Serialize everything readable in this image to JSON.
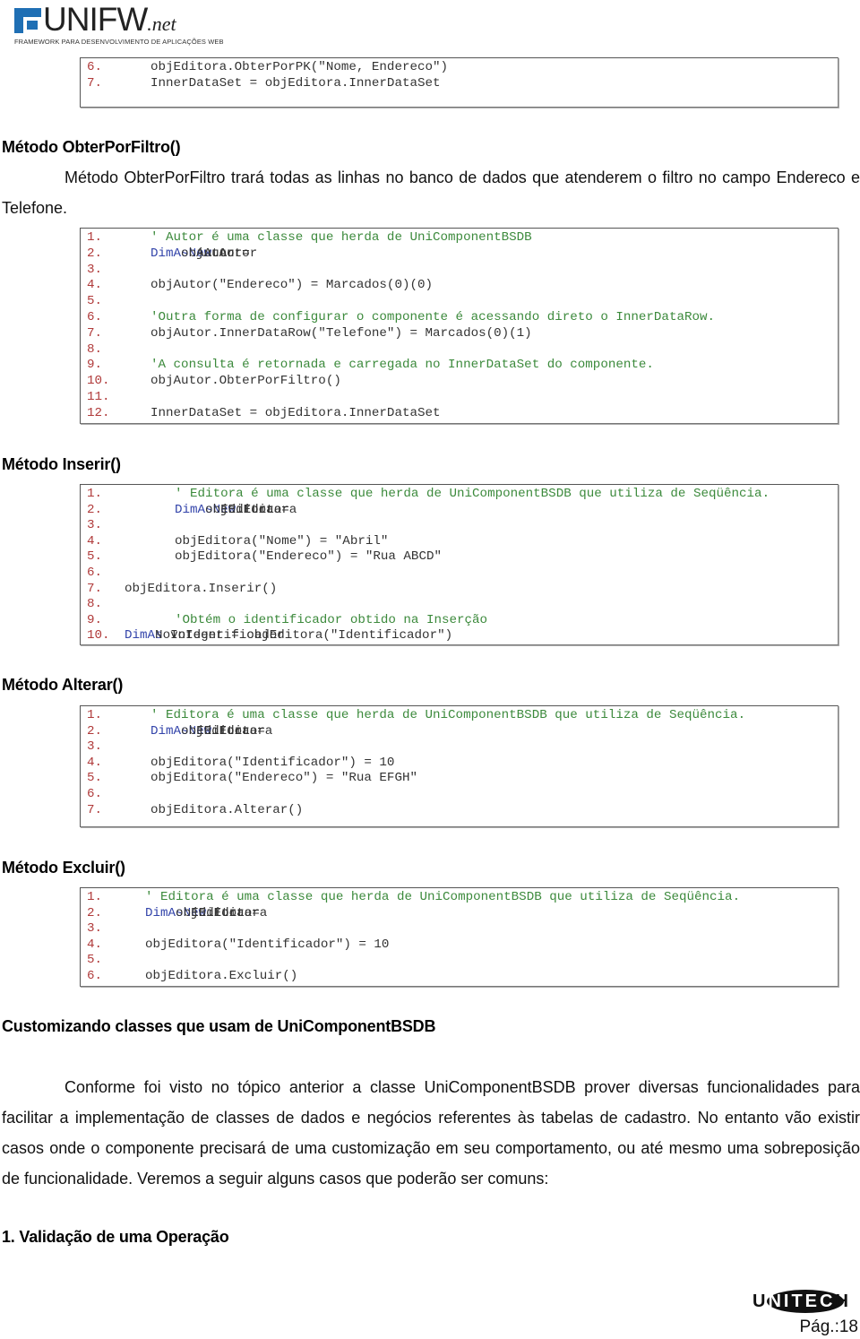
{
  "header": {
    "logo_word": "UNIFW",
    "logo_net": ".net",
    "logo_tagline": "FRAMEWORK PARA DESENVOLVIMENTO DE APLICAÇÕES WEB"
  },
  "blocks": {
    "obterporpk_tail": {
      "lines": [
        {
          "n": "6.",
          "segs": [
            {
              "t": "objEditora.ObterPorPK(\"Nome, Endereco\")",
              "c": "code"
            }
          ]
        },
        {
          "n": "7.",
          "segs": [
            {
              "t": "InnerDataSet = objEditora.InnerDataSet",
              "c": "code"
            }
          ]
        }
      ]
    },
    "obterporfiltro": {
      "heading": "Método ObterPorFiltro()",
      "description": "Método ObterPorFiltro trará todas as linhas no banco de dados que atenderem o filtro no campo Endereco e Telefone.",
      "lines": [
        {
          "n": "1.",
          "segs": [
            {
              "t": "' Autor é uma classe que herda de UniComponentBSDB",
              "c": "cm"
            }
          ]
        },
        {
          "n": "2.",
          "segs": [
            {
              "t": "Dim",
              "c": "kw"
            },
            {
              "t": " objAutor ",
              "c": "code"
            },
            {
              "t": "As",
              "c": "kw"
            },
            {
              "t": " Autor = ",
              "c": "code"
            },
            {
              "t": "New",
              "c": "kw"
            },
            {
              "t": " Autor",
              "c": "code"
            }
          ]
        },
        {
          "n": "3.",
          "segs": []
        },
        {
          "n": "4.",
          "segs": [
            {
              "t": "objAutor(\"Endereco\") = Marcados(0)(0)",
              "c": "code"
            }
          ]
        },
        {
          "n": "5.",
          "segs": []
        },
        {
          "n": "6.",
          "segs": [
            {
              "t": "'Outra forma de configurar o componente é acessando direto o InnerDataRow.",
              "c": "cm"
            }
          ]
        },
        {
          "n": "7.",
          "segs": [
            {
              "t": "objAutor.InnerDataRow(\"Telefone\") = Marcados(0)(1)",
              "c": "code"
            }
          ]
        },
        {
          "n": "8.",
          "segs": []
        },
        {
          "n": "9.",
          "segs": [
            {
              "t": "'A consulta é retornada e carregada no InnerDataSet do componente.",
              "c": "cm"
            }
          ]
        },
        {
          "n": "10.",
          "segs": [
            {
              "t": "objAutor.ObterPorFiltro()",
              "c": "code"
            }
          ]
        },
        {
          "n": "11.",
          "segs": []
        },
        {
          "n": "12.",
          "segs": [
            {
              "t": "InnerDataSet = objEditora.InnerDataSet",
              "c": "code"
            }
          ]
        }
      ]
    },
    "inserir": {
      "heading": "Método Inserir()",
      "lines": [
        {
          "n": "1.",
          "indent": 2,
          "segs": [
            {
              "t": "' Editora é uma classe que herda de UniComponentBSDB que utiliza de Seqüência.",
              "c": "cm"
            }
          ]
        },
        {
          "n": "2.",
          "indent": 2,
          "segs": [
            {
              "t": "Dim",
              "c": "kw"
            },
            {
              "t": " objEditora ",
              "c": "code"
            },
            {
              "t": "As",
              "c": "kw"
            },
            {
              "t": " Editora = ",
              "c": "code"
            },
            {
              "t": "New",
              "c": "kw"
            },
            {
              "t": " Editora",
              "c": "code"
            }
          ]
        },
        {
          "n": "3.",
          "indent": 2,
          "segs": []
        },
        {
          "n": "4.",
          "indent": 2,
          "segs": [
            {
              "t": "objEditora(\"Nome\") = \"Abril\"",
              "c": "code"
            }
          ]
        },
        {
          "n": "5.",
          "indent": 2,
          "segs": [
            {
              "t": "objEditora(\"Endereco\") = \"Rua ABCD\"",
              "c": "code"
            }
          ]
        },
        {
          "n": "6.",
          "indent": 2,
          "segs": []
        },
        {
          "n": "7.",
          "indent": 1,
          "segs": [
            {
              "t": "objEditora.Inserir()",
              "c": "code"
            }
          ]
        },
        {
          "n": "8.",
          "indent": 2,
          "segs": []
        },
        {
          "n": "9.",
          "indent": 2,
          "segs": [
            {
              "t": "'Obtém o identificador obtido na Inserção",
              "c": "cm"
            }
          ]
        },
        {
          "n": "10.",
          "indent": 1,
          "segs": [
            {
              "t": "Dim",
              "c": "kw"
            },
            {
              "t": " NovoIdentificador ",
              "c": "code"
            },
            {
              "t": "As",
              "c": "kw"
            },
            {
              "t": " Integer = objEditora(\"Identificador\")",
              "c": "code"
            }
          ]
        }
      ]
    },
    "alterar": {
      "heading": "Método Alterar()",
      "lines": [
        {
          "n": "1.",
          "segs": [
            {
              "t": "' Editora é uma classe que herda de UniComponentBSDB que utiliza de Seqüência.",
              "c": "cm"
            }
          ]
        },
        {
          "n": "2.",
          "segs": [
            {
              "t": "Dim",
              "c": "kw"
            },
            {
              "t": " objEditora ",
              "c": "code"
            },
            {
              "t": "As",
              "c": "kw"
            },
            {
              "t": " Editora = ",
              "c": "code"
            },
            {
              "t": "New",
              "c": "kw"
            },
            {
              "t": " Editora",
              "c": "code"
            }
          ]
        },
        {
          "n": "3.",
          "segs": []
        },
        {
          "n": "4.",
          "segs": [
            {
              "t": "objEditora(\"Identificador\") = 10",
              "c": "code"
            }
          ]
        },
        {
          "n": "5.",
          "segs": [
            {
              "t": "objEditora(\"Endereco\") = \"Rua EFGH\"",
              "c": "code"
            }
          ]
        },
        {
          "n": "6.",
          "segs": []
        },
        {
          "n": "7.",
          "segs": [
            {
              "t": "objEditora.Alterar()",
              "c": "code"
            }
          ]
        }
      ]
    },
    "excluir": {
      "heading": "Método Excluir()",
      "lines": [
        {
          "n": "1.",
          "segs": [
            {
              "t": "' Editora é uma classe que herda de UniComponentBSDB que utiliza de Seqüência.",
              "c": "cm"
            }
          ]
        },
        {
          "n": "2.",
          "segs": [
            {
              "t": "Dim",
              "c": "kw"
            },
            {
              "t": " objEditora ",
              "c": "code"
            },
            {
              "t": "As",
              "c": "kw"
            },
            {
              "t": " Editora = ",
              "c": "code"
            },
            {
              "t": "New",
              "c": "kw"
            },
            {
              "t": " Editora",
              "c": "code"
            }
          ]
        },
        {
          "n": "3.",
          "segs": []
        },
        {
          "n": "4.",
          "segs": [
            {
              "t": "objEditora(\"Identificador\") = 10",
              "c": "code"
            }
          ]
        },
        {
          "n": "5.",
          "segs": []
        },
        {
          "n": "6.",
          "segs": [
            {
              "t": "objEditora.Excluir()",
              "c": "code"
            }
          ]
        }
      ]
    }
  },
  "customizing": {
    "heading": "Customizando classes que usam de UniComponentBSDB",
    "paragraph": "Conforme foi visto no tópico anterior a classe UniComponentBSDB prover diversas funcionalidades para facilitar a implementação de classes de dados e negócios referentes às tabelas de cadastro. No entanto vão existir casos onde o componente precisará de uma customização em seu comportamento, ou até mesmo uma sobreposição de funcionalidade. Veremos a seguir alguns casos que poderão ser comuns:",
    "subheading": "1. Validação de uma Operação"
  },
  "footer": {
    "logo_text": "UNITECH",
    "page_label": "Pág.:18"
  },
  "colors": {
    "line_number": "#b03a3a",
    "comment": "#3c8a3c",
    "keyword": "#3344aa",
    "code": "#333333",
    "logo_blue": "#1f6fb4"
  }
}
